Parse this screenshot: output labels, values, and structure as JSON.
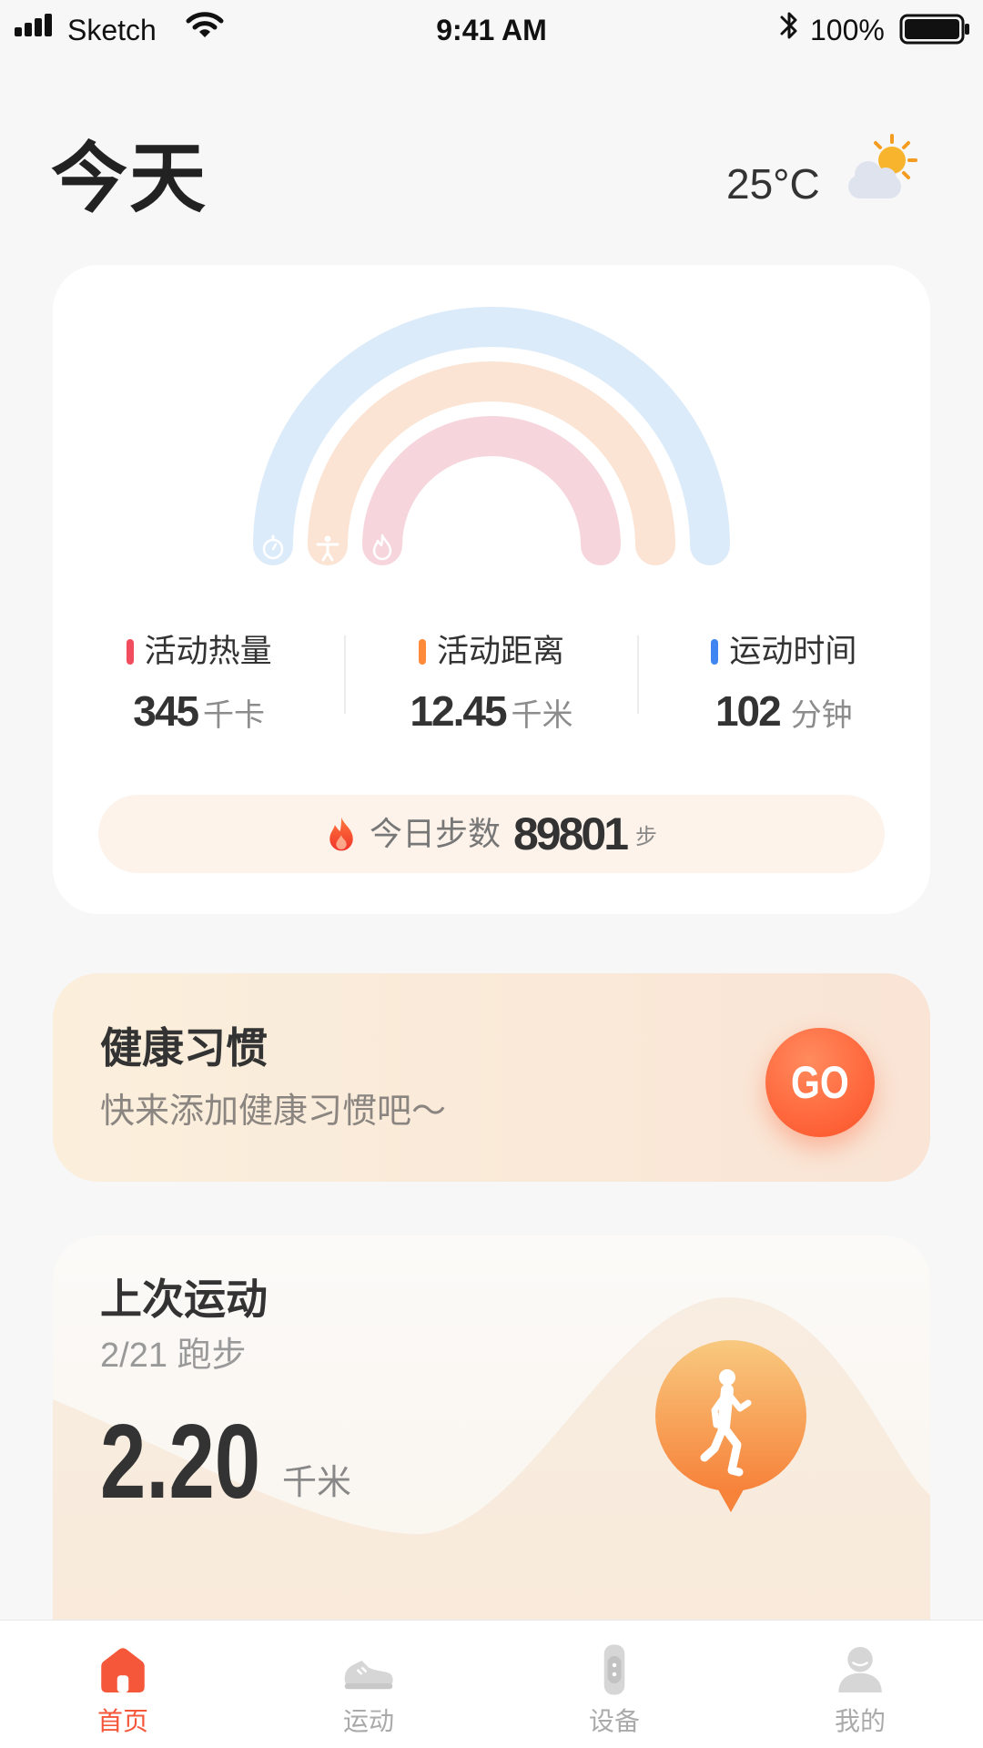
{
  "status_bar": {
    "carrier": "Sketch",
    "time": "9:41 AM",
    "battery": "100%",
    "icons": [
      "signal-icon",
      "wifi-icon",
      "bluetooth-icon",
      "battery-icon"
    ]
  },
  "header": {
    "title": "今天",
    "temperature": "25°C",
    "weather_icon": "partly-sunny-icon"
  },
  "activity": {
    "rings": [
      {
        "icon": "stopwatch-icon",
        "color": "#dcebfa"
      },
      {
        "icon": "body-icon",
        "color": "#fbe4d4"
      },
      {
        "icon": "flame-icon",
        "color": "#f6d6dc"
      }
    ],
    "stats": [
      {
        "label": "活动热量",
        "value": "345",
        "unit": "千卡",
        "color": "#f14d5f"
      },
      {
        "label": "活动距离",
        "value": "12.45",
        "unit": "千米",
        "color": "#ff8a3a"
      },
      {
        "label": "运动时间",
        "value": "102",
        "unit": "分钟",
        "color": "#3f86f2"
      }
    ],
    "steps": {
      "label": "今日步数",
      "value": "89801",
      "unit": "步",
      "icon": "flame-icon"
    }
  },
  "habit": {
    "title": "健康习惯",
    "subtitle": "快来添加健康习惯吧～",
    "button": "GO"
  },
  "last_workout": {
    "title": "上次运动",
    "subtitle": "2/21 跑步",
    "distance": "2.20",
    "unit": "千米",
    "icon": "runner-icon"
  },
  "tab_bar": {
    "active_color": "#f5573a",
    "tabs": [
      {
        "label": "首页",
        "icon": "home-icon",
        "active": true
      },
      {
        "label": "运动",
        "icon": "sneaker-icon",
        "active": false
      },
      {
        "label": "设备",
        "icon": "band-icon",
        "active": false
      },
      {
        "label": "我的",
        "icon": "profile-icon",
        "active": false
      }
    ]
  }
}
